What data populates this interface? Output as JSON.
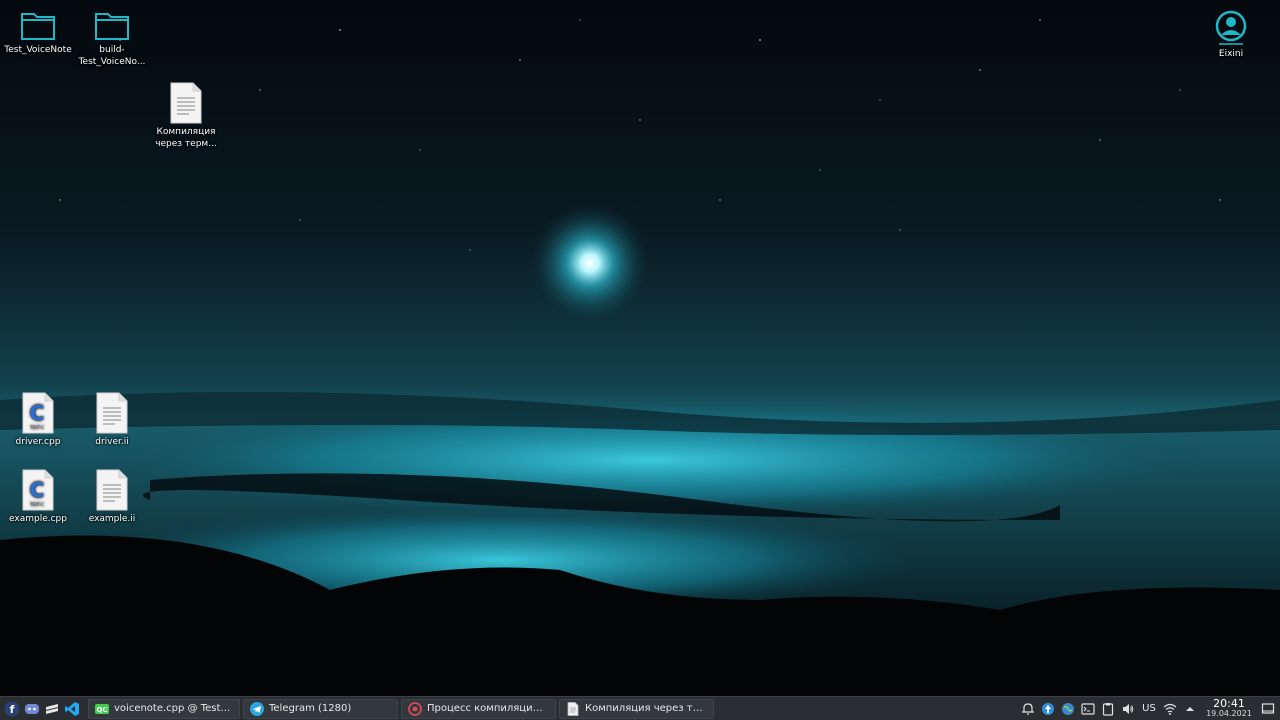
{
  "desktop": {
    "icons": [
      {
        "label": "Test_VoiceNote",
        "icon": "folder-icon"
      },
      {
        "label": "build-Test_VoiceNo...",
        "icon": "folder-icon"
      },
      {
        "label": "Компиляция через терм...",
        "icon": "text-file-icon"
      },
      {
        "label": "driver.cpp",
        "icon": "cpp-file-icon",
        "badge": "C"
      },
      {
        "label": "driver.ii",
        "icon": "text-file-icon"
      },
      {
        "label": "example.cpp",
        "icon": "cpp-file-icon",
        "badge": "C"
      },
      {
        "label": "example.ii",
        "icon": "text-file-icon"
      },
      {
        "label": "Eixini",
        "icon": "user-home-icon"
      }
    ]
  },
  "taskbar": {
    "launchers": [
      "app-menu-icon",
      "discord-icon",
      "sublime-icon",
      "vscode-icon"
    ],
    "tasks": [
      {
        "label": "voicenote.cpp @ Test_Voice...",
        "icon": "qtcreator-icon"
      },
      {
        "label": "Telegram (1280)",
        "icon": "telegram-icon"
      },
      {
        "label": "Процесс компиляции прог...",
        "icon": "browser-icon"
      },
      {
        "label": "Компиляция через термин...",
        "icon": "document-icon"
      }
    ],
    "tray": {
      "keyboard_layout": "US",
      "time": "20:41",
      "date": "19.04.2021"
    }
  },
  "colors": {
    "accent": "#19c3d8",
    "taskbar_bg": "#2a2e32",
    "folder": "#20b8c8"
  }
}
